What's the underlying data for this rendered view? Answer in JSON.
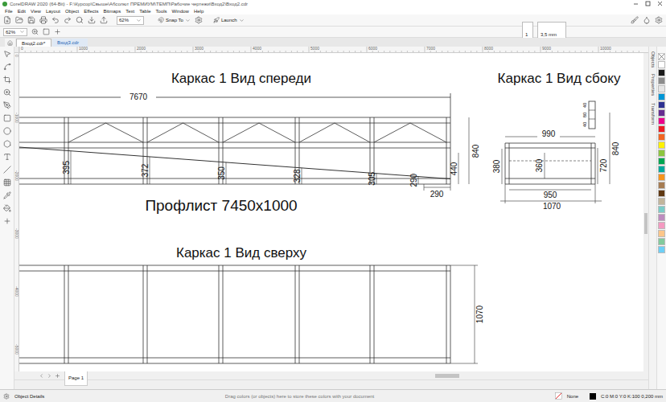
{
  "window": {
    "title": "CorelDRAW 2020 (64-Bit) - F:\\Курсор\\Свыше\\Абсолют ПРЕМИУМ\\ТЕМП\\Рабочие чертежи\\Вход2\\Вход2.cdr"
  },
  "menu": [
    "File",
    "Edit",
    "View",
    "Layout",
    "Object",
    "Effects",
    "Bitmaps",
    "Text",
    "Table",
    "Tools",
    "Window",
    "Help"
  ],
  "toolbar": {
    "zoom": "62%",
    "snap": "Snap To",
    "launch": "Launch"
  },
  "property_bar": {
    "zoom": "62%",
    "page": "1",
    "nudge": "3,5 mm"
  },
  "tabs": [
    {
      "label": "Вход2.cdr*",
      "selected": true
    },
    {
      "label": "Вход3.cdr",
      "selected": false
    }
  ],
  "rulers": {
    "horizontal": [
      "0",
      "1000",
      "2000",
      "3000",
      "4000",
      "5000",
      "6000",
      "7000",
      "8000",
      "9000",
      "10000"
    ],
    "vertical": [
      "0",
      "-1000",
      "-2000",
      "-3000",
      "-4000",
      "-5000"
    ]
  },
  "drawing": {
    "front": {
      "title": "Каркас 1 Вид спереди",
      "length": "7670",
      "heights": [
        "395",
        "372",
        "350",
        "328",
        "305",
        "290"
      ],
      "end_height": "440",
      "total_height": "840",
      "end_width": "290"
    },
    "side": {
      "title": "Каркас 1 Вид сбоку",
      "top_width": "990",
      "inner_width": "950",
      "total_width": "1070",
      "left_height": "380",
      "inner_height": "360",
      "height": "720",
      "total_height": "840",
      "profile": [
        "40",
        "80",
        "40"
      ]
    },
    "sheet": "Профлист 7450x1000",
    "top": {
      "title": "Каркас 1 Вид сверху",
      "width": "1070"
    }
  },
  "dockers": [
    "Objects",
    "Properties",
    "Transform"
  ],
  "palette": [
    {
      "color": "#ffffff"
    },
    {
      "color": "#1a1a1a"
    },
    {
      "color": "#8c8c8c"
    },
    {
      "color": "#e5e5e5"
    },
    {
      "color": "#0096d6"
    },
    {
      "color": "#2e3192"
    },
    {
      "color": "#662d91"
    },
    {
      "color": "#ec008c"
    },
    {
      "color": "#ed1c24"
    },
    {
      "color": "#f26522"
    },
    {
      "color": "#fff200"
    },
    {
      "color": "#8dc63f"
    },
    {
      "color": "#00a651"
    },
    {
      "color": "#00a99d"
    },
    {
      "color": "#f7941d"
    },
    {
      "color": "#a67c52"
    },
    {
      "color": "#603913"
    },
    {
      "color": "#c2b59b"
    },
    {
      "color": "#7accc8"
    },
    {
      "color": "#bd8cbf"
    },
    {
      "color": "#f49ac1"
    },
    {
      "color": "#fdc689"
    },
    {
      "color": "#82ca9c"
    },
    {
      "color": "#6dcff6"
    }
  ],
  "page_nav": {
    "page": "Page 1"
  },
  "status_bar": {
    "left": "Object Details",
    "hint": "Drag colors (or objects) here to store these colors with your document",
    "fill": "None",
    "outline": "C:0 M:0 Y:0 K:100  0,200 mm"
  }
}
